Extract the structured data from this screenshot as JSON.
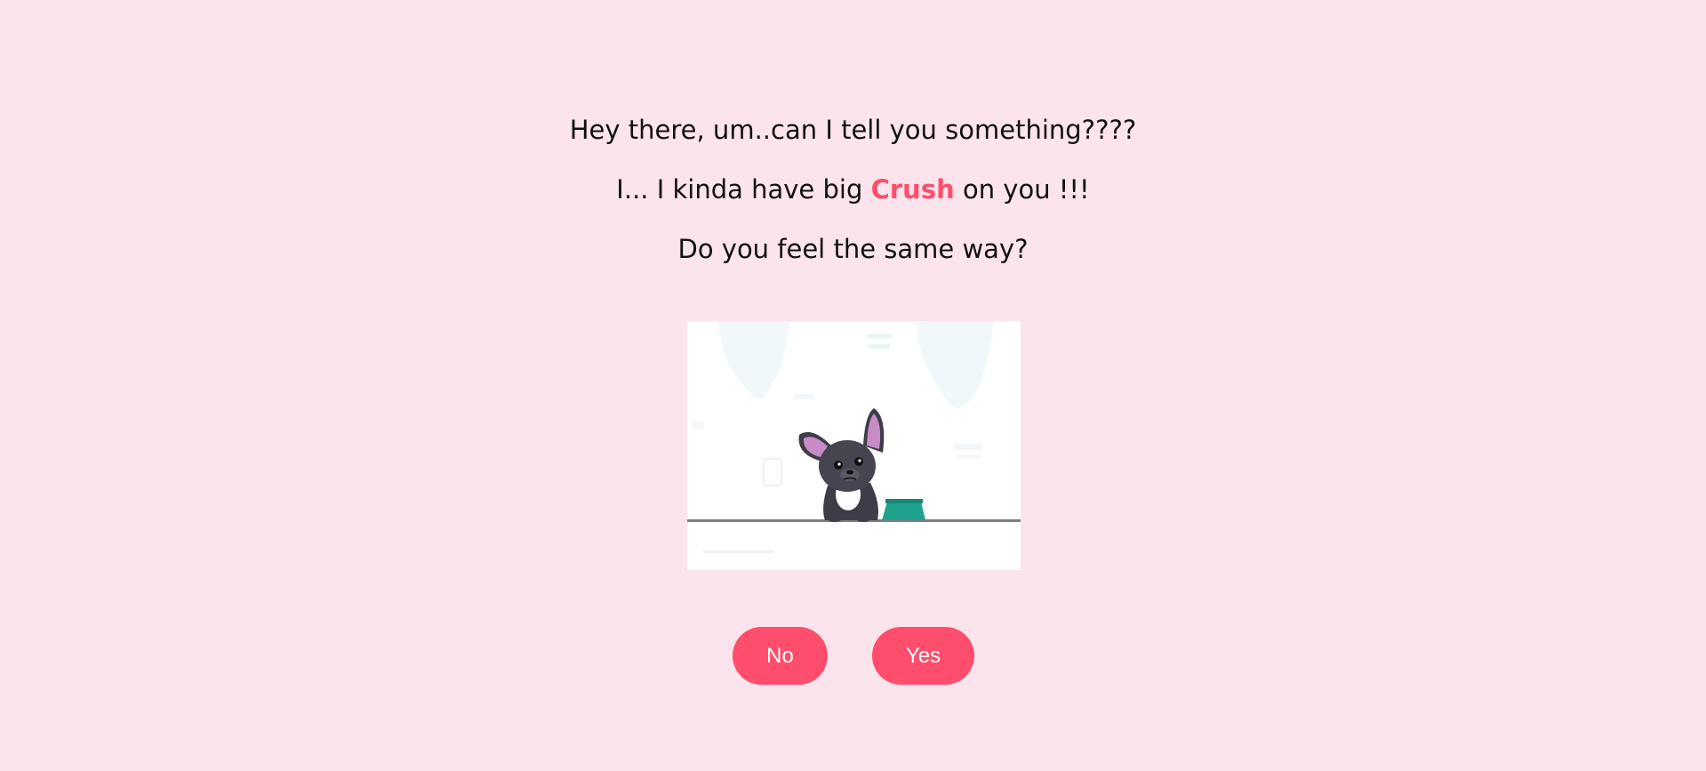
{
  "question": {
    "line1": "Hey there, um..can I tell you something????",
    "line2_before": "I... I kinda have big ",
    "line2_highlight": "Crush",
    "line2_after": " on you !!!",
    "line3": "Do you feel the same way?"
  },
  "illustration": {
    "subject": "sad-puppy-with-bowl"
  },
  "buttons": {
    "no_label": "No",
    "yes_label": "Yes"
  },
  "colors": {
    "background": "#fbe4ec",
    "accent": "#ff4d6d",
    "button_text": "#ffffff"
  }
}
